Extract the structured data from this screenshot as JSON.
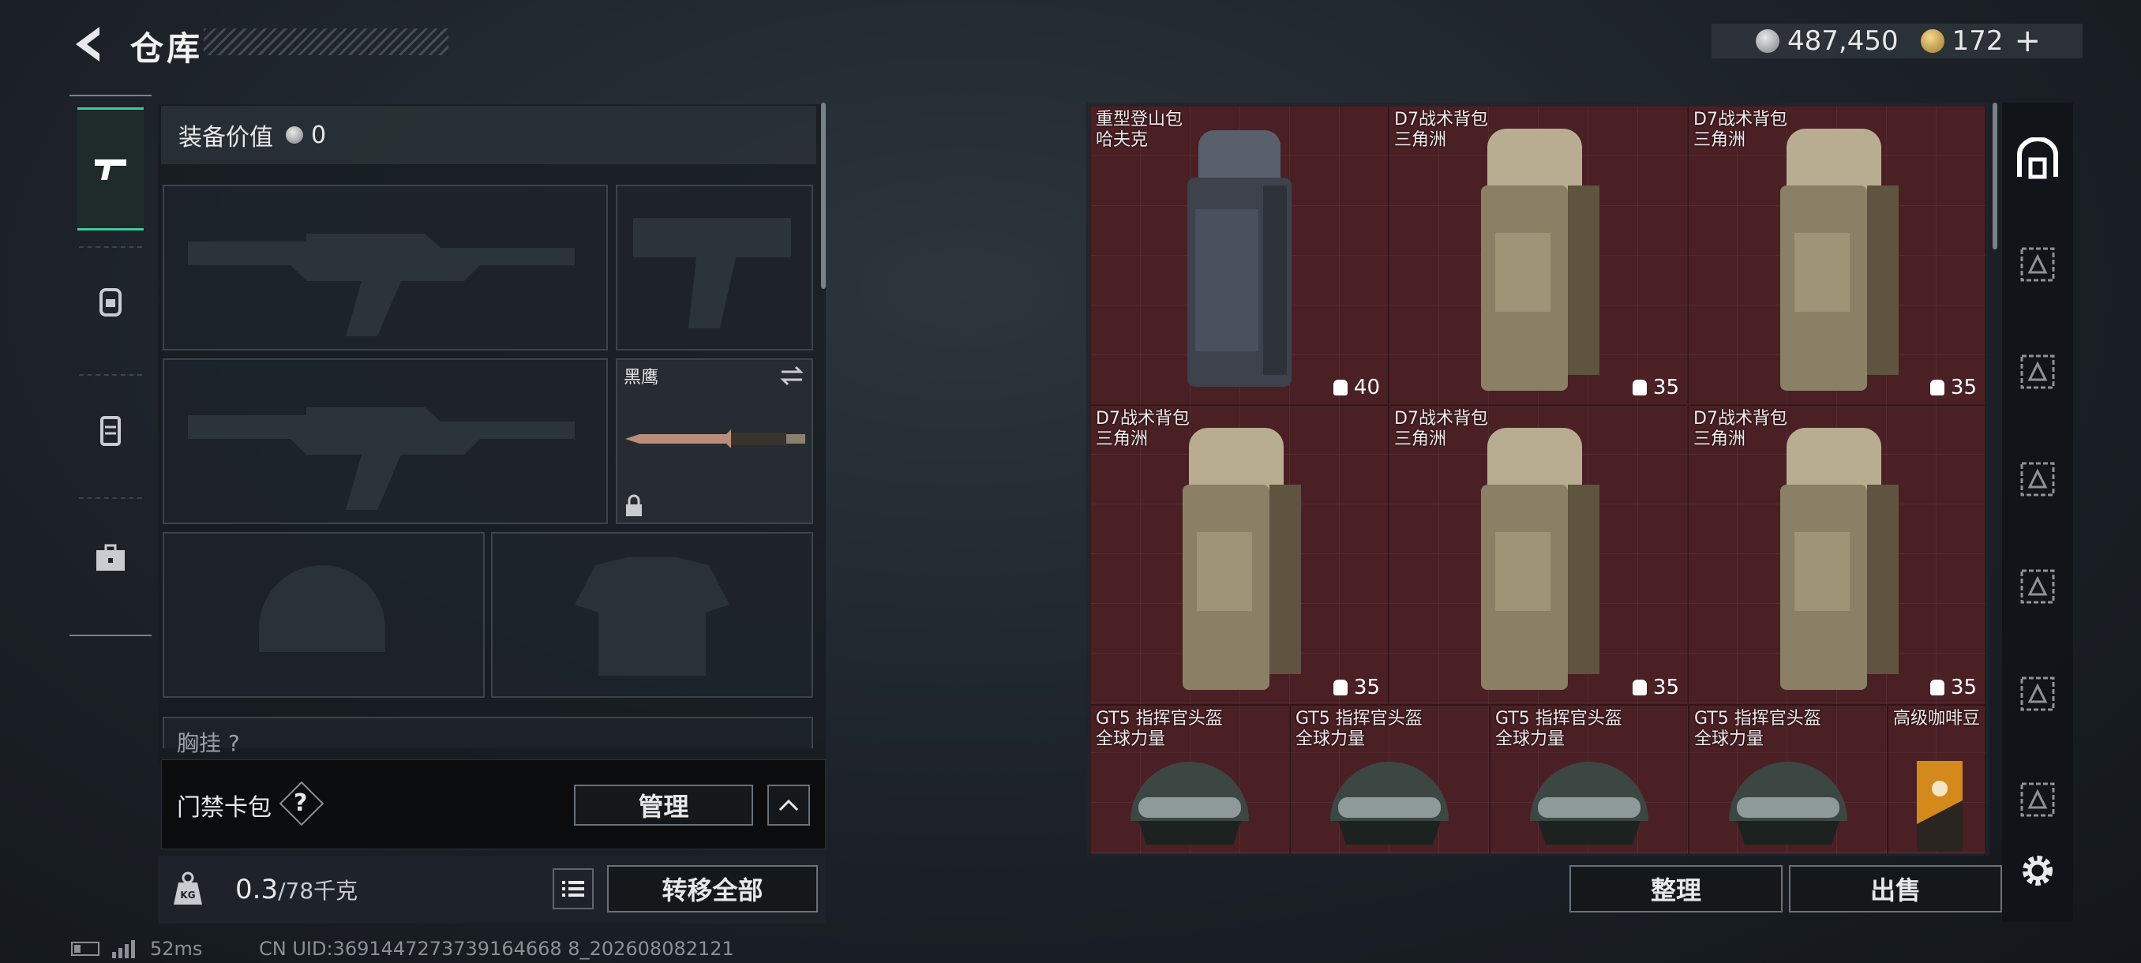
{
  "header": {
    "title": "仓库",
    "currency_silver": "487,450",
    "currency_gold": "172",
    "currency_plus": "+"
  },
  "equipment": {
    "value_label": "装备价值",
    "value": "0",
    "melee_name": "黑鹰",
    "chest_label": "胸挂 ?"
  },
  "card_pack": {
    "label": "门禁卡包",
    "help": "?",
    "manage_label": "管理"
  },
  "weight": {
    "current": "0.3",
    "capacity": "/78千克",
    "transfer_label": "转移全部"
  },
  "status": {
    "ping": "52ms",
    "uid": "CN UID:3691447273739164668 8_202608082121"
  },
  "inventory": {
    "items": [
      {
        "name1": "重型登山包",
        "name2": "哈夫克",
        "capacity": "40"
      },
      {
        "name1": "D7战术背包",
        "name2": "三角洲",
        "capacity": "35"
      },
      {
        "name1": "D7战术背包",
        "name2": "三角洲",
        "capacity": "35"
      },
      {
        "name1": "D7战术背包",
        "name2": "三角洲",
        "capacity": "35"
      },
      {
        "name1": "D7战术背包",
        "name2": "三角洲",
        "capacity": "35"
      },
      {
        "name1": "D7战术背包",
        "name2": "三角洲",
        "capacity": "35"
      },
      {
        "name1": "GT5 指挥官头盔",
        "name2": "全球力量"
      },
      {
        "name1": "GT5 指挥官头盔",
        "name2": "全球力量"
      },
      {
        "name1": "GT5 指挥官头盔",
        "name2": "全球力量"
      },
      {
        "name1": "GT5 指挥官头盔",
        "name2": "全球力量"
      },
      {
        "name1": "高级咖啡豆",
        "name2": ""
      }
    ],
    "sort_label": "整理",
    "sell_label": "出售"
  },
  "colors": {
    "inventory_bg": "#4a2025",
    "accent": "#3fcaa0"
  }
}
